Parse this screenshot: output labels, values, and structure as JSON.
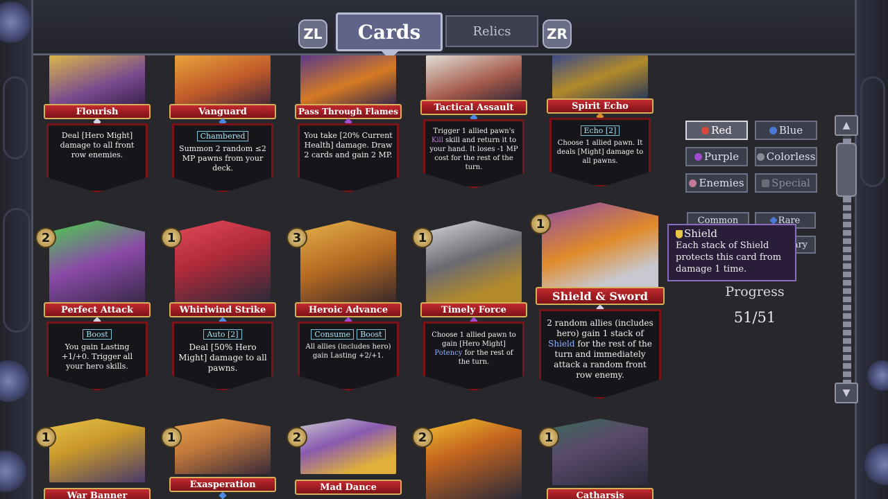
{
  "tabs": {
    "left_shoulder": "ZL",
    "cards": "Cards",
    "relics": "Relics",
    "right_shoulder": "ZR"
  },
  "cards_row1": [
    {
      "name": "Flourish",
      "text": "Deal [Hero Might] damage to all front row enemies.",
      "art_color": "#7a4b8e"
    },
    {
      "name": "Vanguard",
      "keyword": "Chambered",
      "text": "Summon 2 random ≤2 MP pawns from your deck.",
      "art_color": "#c05a2a"
    },
    {
      "name": "Pass Through Flames",
      "text": "You take [20% Current Health] damage. Draw 2 cards and gain 2 MP.",
      "art_color": "#d67a22"
    },
    {
      "name": "Tactical Assault",
      "text_pre": "Trigger 1 allied pawn's ",
      "text_kill": "Kill",
      "text_post": " skill and return it to your hand. It loses -1 MP cost for the rest of the turn.",
      "art_color": "#a45a4a"
    },
    {
      "name": "Spirit Echo",
      "keyword": "Echo [2]",
      "text": "Choose 1 allied pawn. It deals [Might] damage to all pawns.",
      "art_color": "#3a6b8a"
    }
  ],
  "cards_row2": [
    {
      "name": "Perfect Attack",
      "cost": "2",
      "keyword": "Boost",
      "text": "You gain Lasting +1/+0. Trigger all your hero skills.",
      "art_color": "#8a4aa8"
    },
    {
      "name": "Whirlwind Strike",
      "cost": "1",
      "keyword": "Auto [2]",
      "text": "Deal [50% Hero Might] damage to all pawns.",
      "art_color": "#b02a3a"
    },
    {
      "name": "Heroic Advance",
      "cost": "3",
      "keyword": "Consume",
      "keyword2": "Boost",
      "text": "All allies (includes hero) gain Lasting +2/+1.",
      "art_color": "#b56a22"
    },
    {
      "name": "Timely Force",
      "cost": "1",
      "text_pre": "Choose 1 allied pawn to gain [Hero Might] ",
      "text_potency": "Potency",
      "text_post": " for the rest of the turn.",
      "art_color": "#6a6a72"
    },
    {
      "name": "Shield & Sword",
      "cost": "1",
      "text_pre": "2 random allies (includes hero) gain 1 stack of ",
      "text_shield": "Shield",
      "text_post": " for the rest of the turn and immediately attack a random front row enemy.",
      "art_color": "#c06a2a"
    }
  ],
  "cards_row3": [
    {
      "name": "War Banner",
      "cost": "1",
      "art_color": "#c99a2a"
    },
    {
      "name": "Exasperation",
      "cost": "1",
      "art_color": "#c47a3a"
    },
    {
      "name": "Mad Dance",
      "cost": "2",
      "art_color": "#8a5ab0"
    },
    {
      "name": "",
      "cost": "2",
      "art_color": "#c4641e"
    },
    {
      "name": "Catharsis",
      "cost": "1",
      "art_color": "#5a4a6a"
    }
  ],
  "filters": {
    "red": "Red",
    "blue": "Blue",
    "purple": "Purple",
    "colorless": "Colorless",
    "enemies": "Enemies",
    "special": "Special",
    "common": "Common",
    "rare": "Rare",
    "legendary": "ary"
  },
  "colors": {
    "red": "#d9483a",
    "blue": "#4a78d8",
    "purple": "#a24ad0",
    "colorless": "#8a8d96"
  },
  "tooltip": {
    "title": "Shield",
    "text": "Each stack of Shield protects this card from damage 1 time."
  },
  "progress": {
    "label": "Progress",
    "value": "51/51"
  }
}
